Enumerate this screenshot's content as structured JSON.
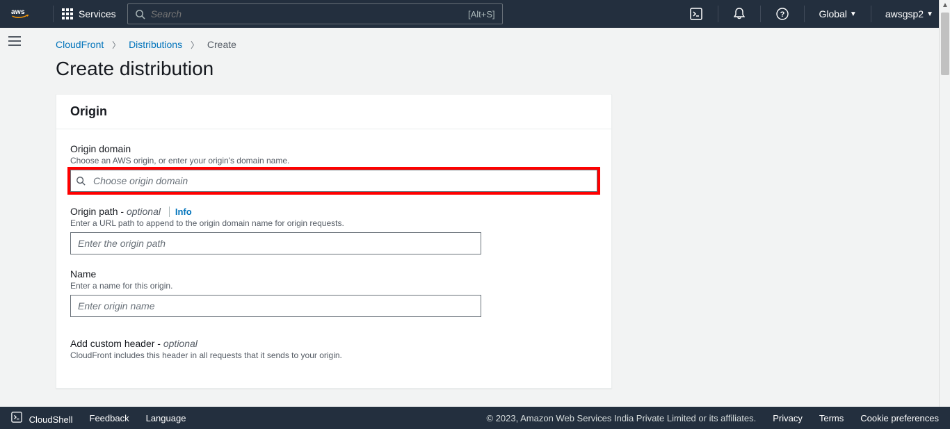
{
  "nav": {
    "services_label": "Services",
    "search_placeholder": "Search",
    "search_shortcut": "[Alt+S]",
    "region": "Global",
    "user": "awsgsp2"
  },
  "breadcrumb": {
    "item1": "CloudFront",
    "item2": "Distributions",
    "item3": "Create"
  },
  "page": {
    "title": "Create distribution"
  },
  "origin": {
    "section_title": "Origin",
    "domain_label": "Origin domain",
    "domain_hint": "Choose an AWS origin, or enter your origin's domain name.",
    "domain_placeholder": "Choose origin domain",
    "path_label": "Origin path - ",
    "path_optional": "optional",
    "path_info": "Info",
    "path_hint": "Enter a URL path to append to the origin domain name for origin requests.",
    "path_placeholder": "Enter the origin path",
    "name_label": "Name",
    "name_hint": "Enter a name for this origin.",
    "name_placeholder": "Enter origin name",
    "custom_header_label": "Add custom header - ",
    "custom_header_optional": "optional",
    "custom_header_hint": "CloudFront includes this header in all requests that it sends to your origin."
  },
  "footer": {
    "cloudshell": "CloudShell",
    "feedback": "Feedback",
    "language": "Language",
    "copyright": "© 2023, Amazon Web Services India Private Limited or its affiliates.",
    "privacy": "Privacy",
    "terms": "Terms",
    "cookie": "Cookie preferences"
  }
}
